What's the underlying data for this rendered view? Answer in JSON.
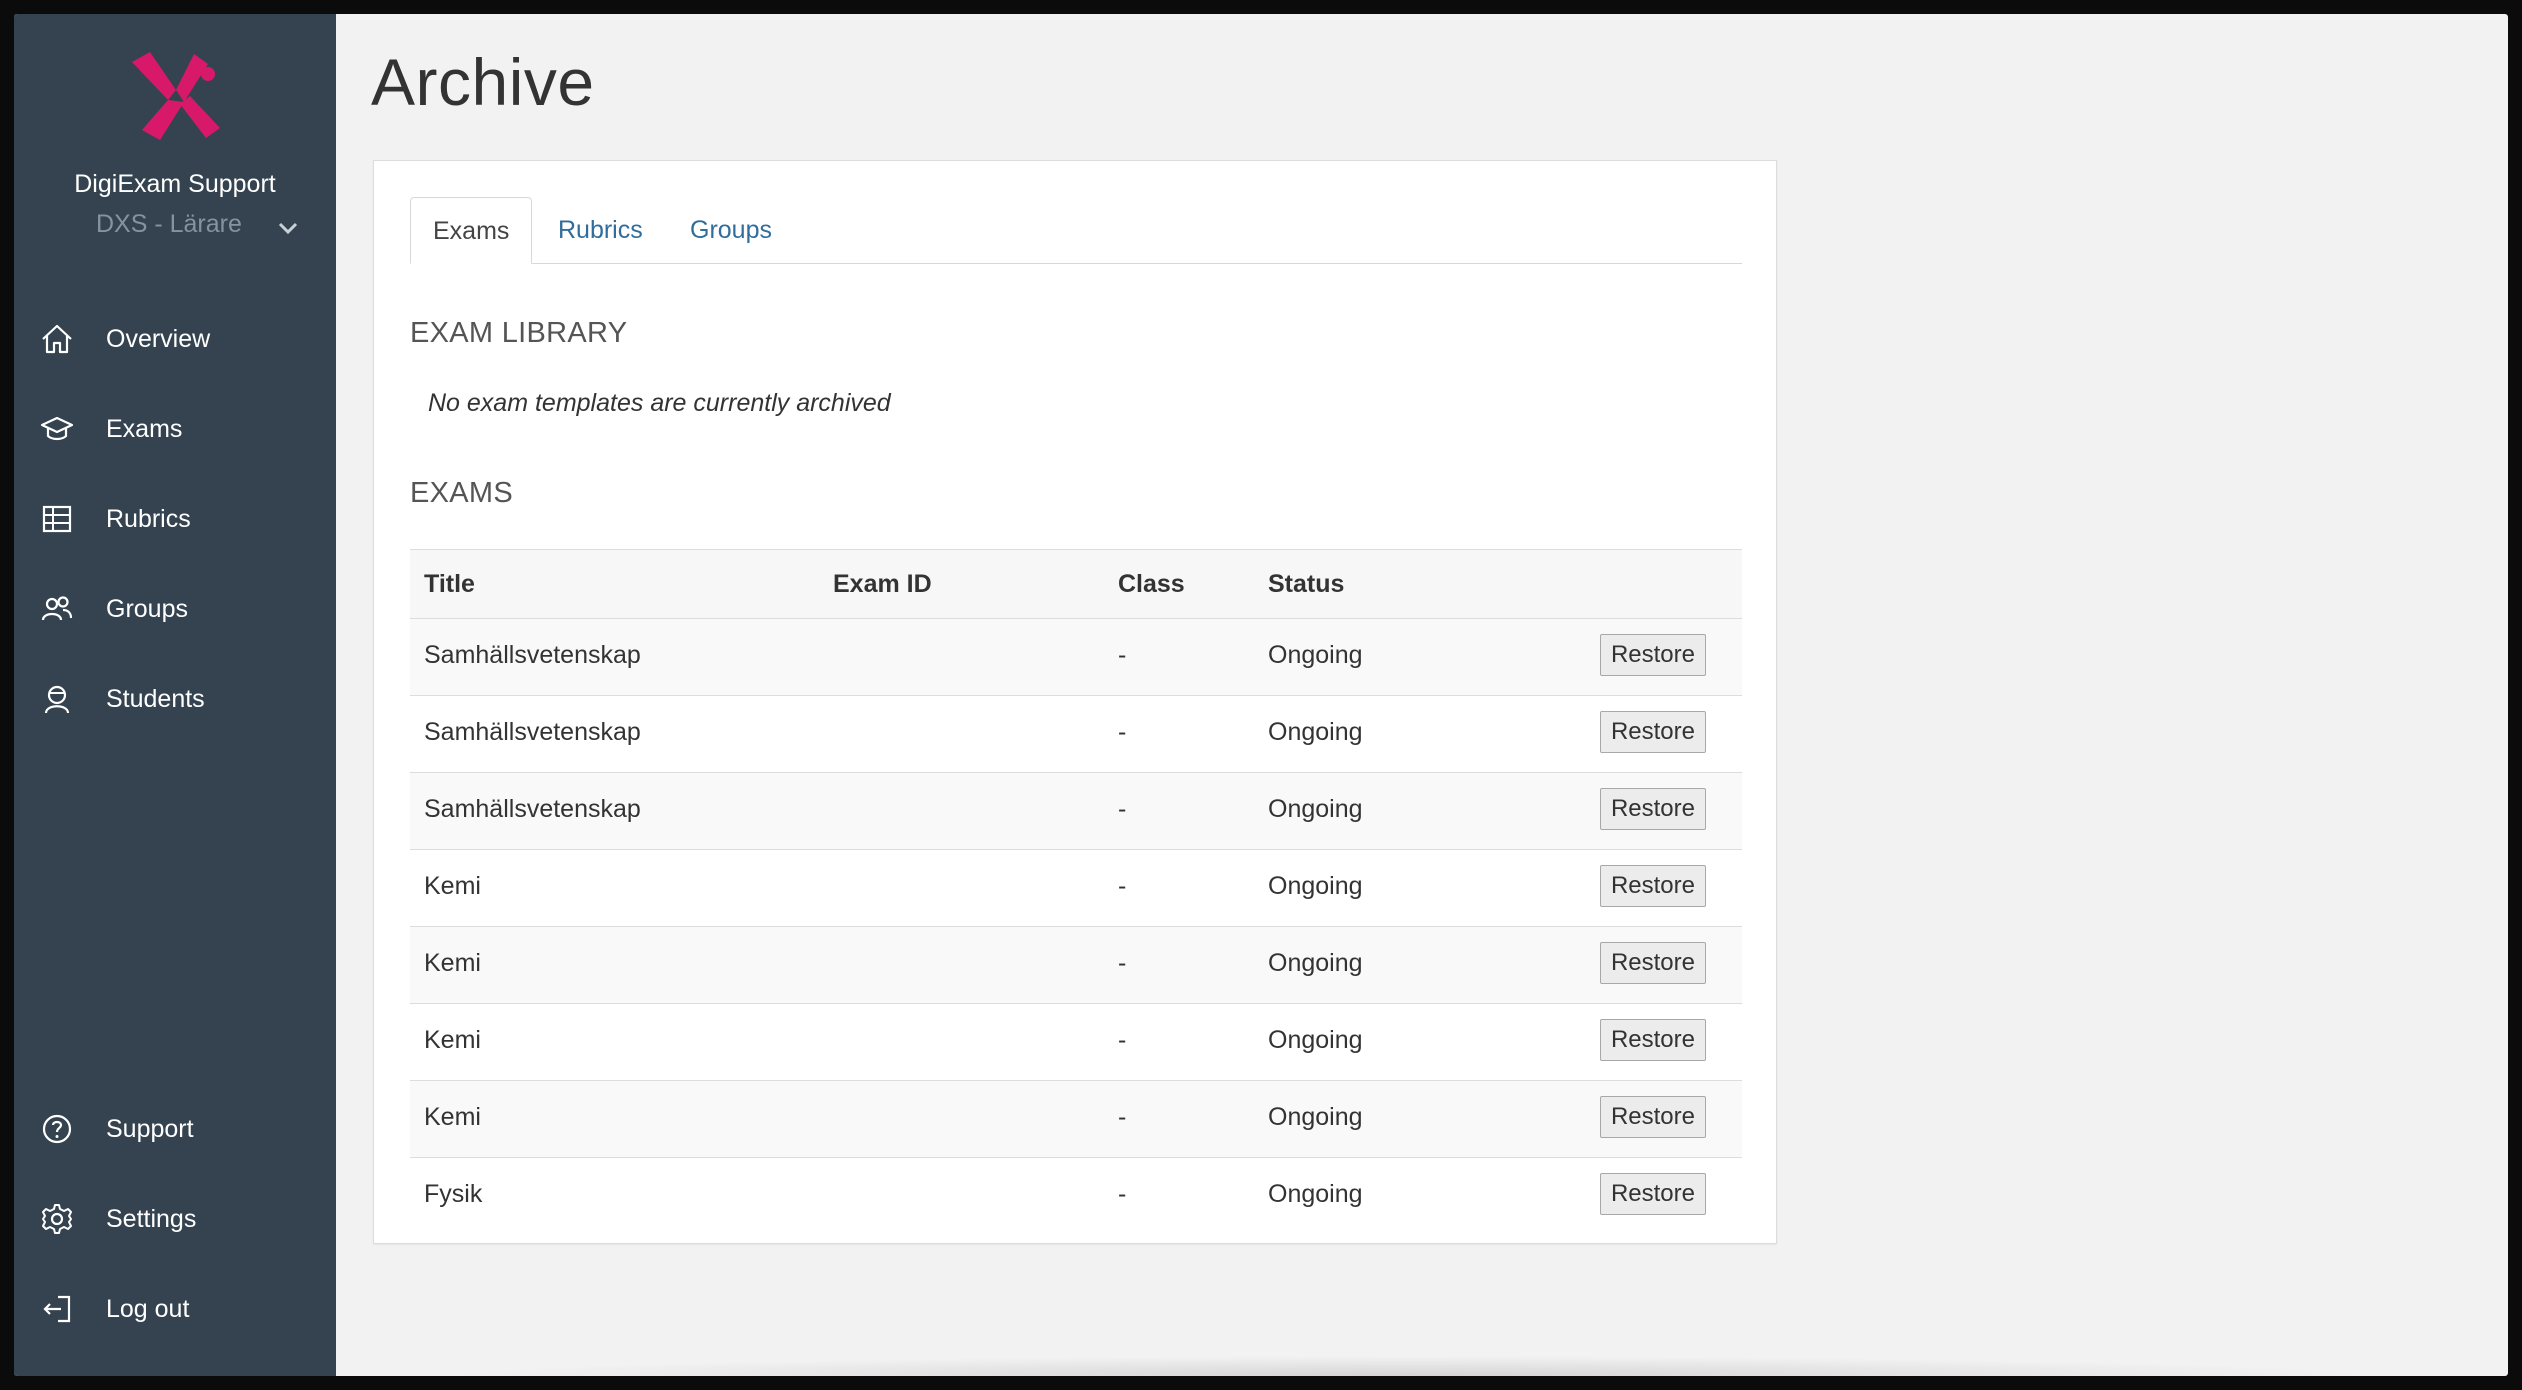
{
  "sidebar": {
    "org_name": "DigiExam Support",
    "org_select_value": "DXS - Lärare",
    "nav_top": [
      {
        "label": "Overview",
        "icon": "home-icon"
      },
      {
        "label": "Exams",
        "icon": "graduation-cap-icon"
      },
      {
        "label": "Rubrics",
        "icon": "table-grid-icon"
      },
      {
        "label": "Groups",
        "icon": "users-icon"
      },
      {
        "label": "Students",
        "icon": "student-icon"
      }
    ],
    "nav_bottom": [
      {
        "label": "Support",
        "icon": "help-circle-icon"
      },
      {
        "label": "Settings",
        "icon": "gear-icon"
      },
      {
        "label": "Log out",
        "icon": "logout-icon"
      }
    ]
  },
  "page": {
    "title": "Archive"
  },
  "tabs": [
    {
      "label": "Exams",
      "active": true
    },
    {
      "label": "Rubrics",
      "active": false
    },
    {
      "label": "Groups",
      "active": false
    }
  ],
  "exam_library": {
    "heading": "EXAM LIBRARY",
    "empty_note": "No exam templates are currently archived"
  },
  "exams": {
    "heading": "EXAMS",
    "columns": {
      "title": "Title",
      "exam_id": "Exam ID",
      "class": "Class",
      "status": "Status"
    },
    "rows": [
      {
        "title": "Samhällsvetenskap",
        "exam_id": "",
        "class": "-",
        "status": "Ongoing",
        "action": "Restore"
      },
      {
        "title": "Samhällsvetenskap",
        "exam_id": "",
        "class": "-",
        "status": "Ongoing",
        "action": "Restore"
      },
      {
        "title": "Samhällsvetenskap",
        "exam_id": "",
        "class": "-",
        "status": "Ongoing",
        "action": "Restore"
      },
      {
        "title": "Kemi",
        "exam_id": "",
        "class": "-",
        "status": "Ongoing",
        "action": "Restore"
      },
      {
        "title": "Kemi",
        "exam_id": "",
        "class": "-",
        "status": "Ongoing",
        "action": "Restore"
      },
      {
        "title": "Kemi",
        "exam_id": "",
        "class": "-",
        "status": "Ongoing",
        "action": "Restore"
      },
      {
        "title": "Kemi",
        "exam_id": "",
        "class": "-",
        "status": "Ongoing",
        "action": "Restore"
      },
      {
        "title": "Fysik",
        "exam_id": "",
        "class": "-",
        "status": "Ongoing",
        "action": "Restore"
      }
    ]
  },
  "colors": {
    "sidebar_bg": "#34434f",
    "brand_pink": "#d8196a",
    "link_blue": "#2f6e9c",
    "page_bg": "#f2f2f2"
  }
}
